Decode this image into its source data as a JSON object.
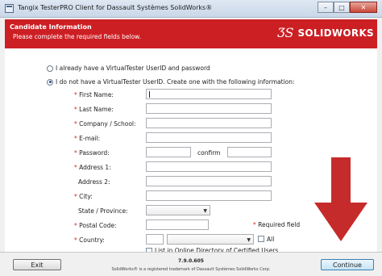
{
  "window": {
    "title": "Tangix TesterPRO Client for Dassault Systèmes SolidWorks®",
    "minimize": "–",
    "maximize": "□",
    "close": "✕"
  },
  "header": {
    "title": "Candidate Information",
    "subtitle": "Please complete the required fields below.",
    "logo_mark": "ƷS",
    "logo_text": "SOLIDWORKS",
    "color": "#cc1f24"
  },
  "account": {
    "option_existing": "I already have a VirtualTester UserID and password",
    "option_new": "I do not have a VirtualTester UserID. Create one with the following information:",
    "selected": "option_new"
  },
  "form": {
    "first_name": {
      "req": "* ",
      "label": "First Name:",
      "value": ""
    },
    "last_name": {
      "req": "* ",
      "label": "Last Name:",
      "value": ""
    },
    "company": {
      "req": "* ",
      "label": "Company / School:",
      "value": ""
    },
    "email": {
      "req": "* ",
      "label": "E-mail:",
      "value": ""
    },
    "password": {
      "req": "* ",
      "label": "Password:",
      "value": "",
      "confirm_label": "confirm",
      "confirm_value": ""
    },
    "address1": {
      "req": "* ",
      "label": "Address 1:",
      "value": ""
    },
    "address2": {
      "label": "Address 2:",
      "value": ""
    },
    "city": {
      "req": "* ",
      "label": "City:",
      "value": ""
    },
    "state": {
      "label": "State / Province:",
      "value": ""
    },
    "postal": {
      "req": "* ",
      "label": "Postal Code:",
      "value": ""
    },
    "required_note_star": "* ",
    "required_note": "Required field",
    "country": {
      "req": "* ",
      "label": "Country:",
      "value": "",
      "all_label": "All"
    },
    "list_directory": "List in Online Directory of Certified Users"
  },
  "footer": {
    "exit": "Exit",
    "continue": "Continue",
    "version": "7.9.0.605",
    "trademark": "SolidWorks® is a registered trademark of Dassault Systèmes SolidWorks Corp."
  },
  "icons": {
    "annotation_arrow": "arrow-down",
    "annotation_arrow_color": "#c62b2b"
  }
}
